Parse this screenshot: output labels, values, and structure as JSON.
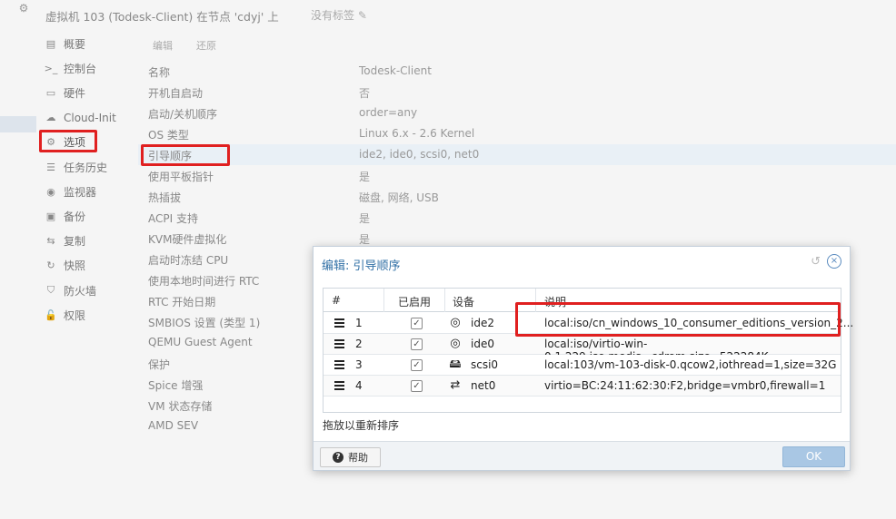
{
  "topbar": {
    "title": "虚拟机 103 (Todesk-Client) 在节点 'cdyj' 上",
    "notes": "没有标签 ✎"
  },
  "nav": {
    "items": [
      {
        "label": "概要",
        "icon": "summary-icon"
      },
      {
        "label": "控制台",
        "icon": "console-icon"
      },
      {
        "label": "硬件",
        "icon": "monitor-icon"
      },
      {
        "label": "Cloud-Init",
        "icon": "cloud-icon"
      },
      {
        "label": "选项",
        "icon": "gear-icon"
      },
      {
        "label": "任务历史",
        "icon": "list-icon"
      },
      {
        "label": "监视器",
        "icon": "eye-icon"
      },
      {
        "label": "备份",
        "icon": "floppy-icon"
      },
      {
        "label": "复制",
        "icon": "retweet-icon"
      },
      {
        "label": "快照",
        "icon": "history-icon"
      },
      {
        "label": "防火墙",
        "icon": "shield-icon"
      },
      {
        "label": "权限",
        "icon": "unlock-icon"
      }
    ]
  },
  "toolbar": {
    "edit": "编辑",
    "revert": "还原"
  },
  "options": [
    {
      "key": "名称",
      "value": "Todesk-Client"
    },
    {
      "key": "开机自启动",
      "value": "否"
    },
    {
      "key": "启动/关机顺序",
      "value": "order=any"
    },
    {
      "key": "OS 类型",
      "value": "Linux 6.x - 2.6 Kernel"
    },
    {
      "key": "引导顺序",
      "value": "ide2, ide0, scsi0, net0"
    },
    {
      "key": "使用平板指针",
      "value": "是"
    },
    {
      "key": "热插拔",
      "value": "磁盘, 网络, USB"
    },
    {
      "key": "ACPI 支持",
      "value": "是"
    },
    {
      "key": "KVM硬件虚拟化",
      "value": "是"
    },
    {
      "key": "启动时冻结 CPU",
      "value": ""
    },
    {
      "key": "使用本地时间进行 RTC",
      "value": ""
    },
    {
      "key": "RTC 开始日期",
      "value": ""
    },
    {
      "key": "SMBIOS 设置 (类型 1)",
      "value": ""
    },
    {
      "key": "QEMU Guest Agent",
      "value": ""
    },
    {
      "key": "保护",
      "value": ""
    },
    {
      "key": "Spice 增强",
      "value": ""
    },
    {
      "key": "VM 状态存储",
      "value": ""
    },
    {
      "key": "AMD SEV",
      "value": ""
    }
  ],
  "modal": {
    "title": "编辑: 引导顺序",
    "columns": {
      "num": "#",
      "enabled": "已启用",
      "device": "设备",
      "desc": "说明"
    },
    "rows": [
      {
        "num": "1",
        "enabled": "✓",
        "icon": "disc-icon",
        "glyph": "◎",
        "device": "ide2",
        "desc": "local:iso/cn_windows_10_consumer_editions_version_2..."
      },
      {
        "num": "2",
        "enabled": "✓",
        "icon": "disc-icon",
        "glyph": "◎",
        "device": "ide0",
        "desc": "local:iso/virtio-win-0.1.229.iso,media=cdrom,size=522284K"
      },
      {
        "num": "3",
        "enabled": "✓",
        "icon": "hdd-icon",
        "glyph": "🖴",
        "device": "scsi0",
        "desc": "local:103/vm-103-disk-0.qcow2,iothread=1,size=32G"
      },
      {
        "num": "4",
        "enabled": "✓",
        "icon": "exchange-icon",
        "glyph": "⇄",
        "device": "net0",
        "desc": "virtio=BC:24:11:62:30:F2,bridge=vmbr0,firewall=1"
      }
    ],
    "hint": "拖放以重新排序",
    "help": "帮助",
    "ok": "OK",
    "undo_glyph": "↺",
    "close_glyph": "×"
  }
}
